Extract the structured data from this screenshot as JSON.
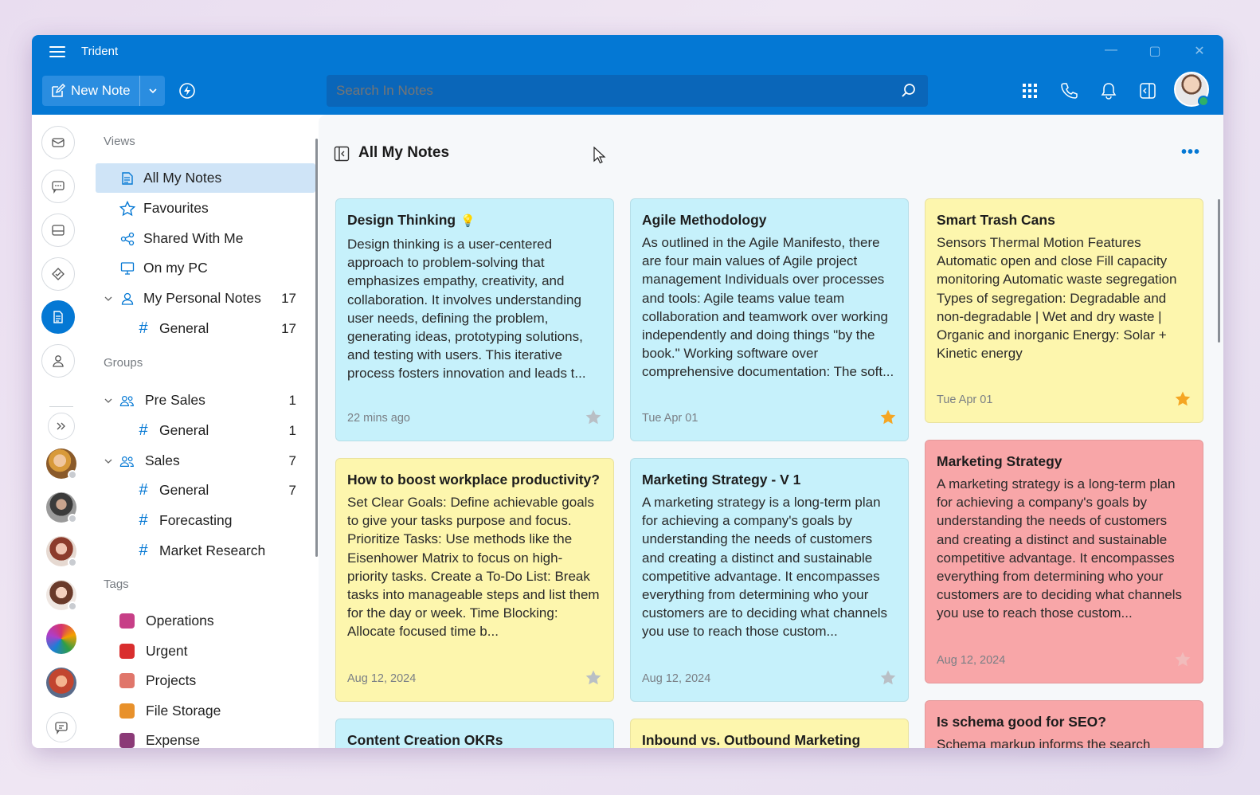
{
  "app": {
    "title": "Trident"
  },
  "toolbar": {
    "new_note_label": "New Note",
    "search_placeholder": "Search In Notes"
  },
  "sidebar": {
    "views_header": "Views",
    "views": [
      {
        "label": "All My Notes"
      },
      {
        "label": "Favourites"
      },
      {
        "label": "Shared With Me"
      },
      {
        "label": "On my PC"
      },
      {
        "label": "My Personal Notes",
        "count": "17"
      },
      {
        "label": "General",
        "count": "17"
      }
    ],
    "groups_header": "Groups",
    "groups": [
      {
        "label": "Pre Sales",
        "count": "1"
      },
      {
        "label": "General",
        "count": "1"
      },
      {
        "label": "Sales",
        "count": "7"
      },
      {
        "label": "General",
        "count": "7"
      },
      {
        "label": "Forecasting"
      },
      {
        "label": "Market Research"
      }
    ],
    "tags_header": "Tags",
    "tags": [
      {
        "label": "Operations",
        "color": "#c73f87"
      },
      {
        "label": "Urgent",
        "color": "#d92e2e"
      },
      {
        "label": "Projects",
        "color": "#e0766b"
      },
      {
        "label": "File Storage",
        "color": "#e8912b"
      },
      {
        "label": "Expense",
        "color": "#8b3a77"
      }
    ]
  },
  "main": {
    "title": "All My Notes",
    "notes": [
      {
        "title": "Design Thinking",
        "body": "Design thinking is a user-centered approach to problem-solving that emphasizes empathy, creativity, and collaboration. It involves understanding user needs, defining the problem, generating ideas, prototyping solutions, and testing with users. This iterative process fosters innovation and leads t...",
        "date": "22 mins ago",
        "starred": false,
        "color": "blue"
      },
      {
        "title": "Agile Methodology",
        "body": "As outlined in the Agile Manifesto, there are four main values of Agile project management Individuals over processes and tools: Agile teams value team collaboration and teamwork over working independently and doing things \"by the book.\" Working software over comprehensive documentation: The soft...",
        "date": "Tue Apr 01",
        "starred": true,
        "color": "blue"
      },
      {
        "title": "Smart Trash Cans",
        "body": "Sensors Thermal Motion Features Automatic open and close Fill capacity monitoring Automatic waste segregation Types of segregation: Degradable and non-degradable | Wet and dry waste | Organic and inorganic Energy: Solar + Kinetic energy",
        "date": "Tue Apr 01",
        "starred": true,
        "color": "yellow"
      },
      {
        "title": "How to boost workplace productivity?",
        "body": "Set Clear Goals: Define achievable goals to give your tasks purpose and focus. Prioritize Tasks: Use methods like the Eisenhower Matrix to focus on high-priority tasks. Create a To-Do List: Break tasks into manageable steps and list them for the day or week. Time Blocking: Allocate focused time b...",
        "date": "Aug 12, 2024",
        "starred": false,
        "color": "yellow"
      },
      {
        "title": "Marketing Strategy - V 1",
        "body": "A marketing strategy is a long-term plan for achieving a company's goals by understanding the needs of customers and creating a distinct and sustainable competitive advantage. It encompasses everything from determining who your customers are to deciding what channels you use to reach those custom...",
        "date": "Aug 12, 2024",
        "starred": false,
        "color": "blue"
      },
      {
        "title": "Marketing Strategy",
        "body": "A marketing strategy is a long-term plan for achieving a company's goals by understanding the needs of customers and creating a distinct and sustainable competitive advantage. It encompasses everything from determining who your customers are to deciding what channels you use to reach those custom...",
        "date": "Aug 12, 2024",
        "starred": false,
        "color": "red"
      },
      {
        "title": "Content Creation OKRs",
        "body": "",
        "date": "",
        "starred": false,
        "color": "blue"
      },
      {
        "title": "Inbound vs. Outbound Marketing",
        "body": "",
        "date": "",
        "starred": false,
        "color": "yellow"
      },
      {
        "title": "Is schema good for SEO?",
        "body": "Schema markup informs the search",
        "date": "",
        "starred": false,
        "color": "red"
      }
    ]
  },
  "colors": {
    "accent": "#0478d4",
    "star_on": "#f5a623",
    "star_off": "#b9bfc5"
  }
}
